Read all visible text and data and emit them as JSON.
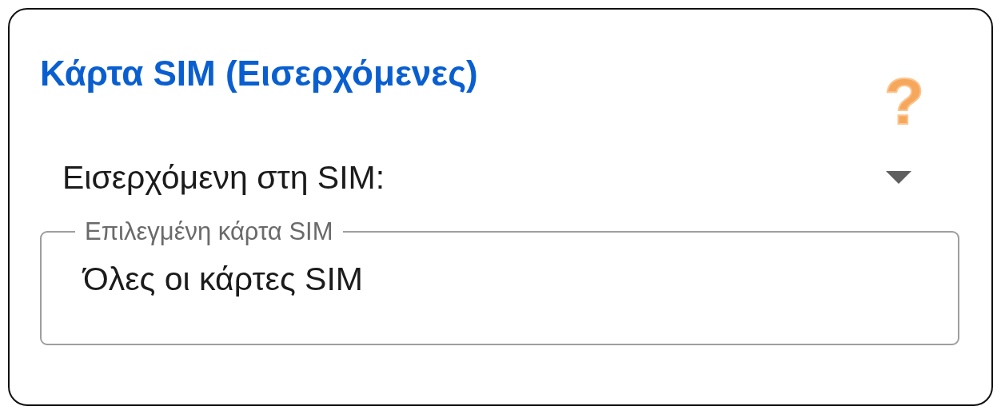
{
  "title": "Κάρτα SIM (Εισερχόμενες)",
  "help": "?",
  "dropdown": {
    "label": "Εισερχόμενη στη SIM:",
    "expanded": false
  },
  "field": {
    "label": "Επιλεγμένη κάρτα SIM",
    "value": "Όλες οι κάρτες SIM"
  }
}
